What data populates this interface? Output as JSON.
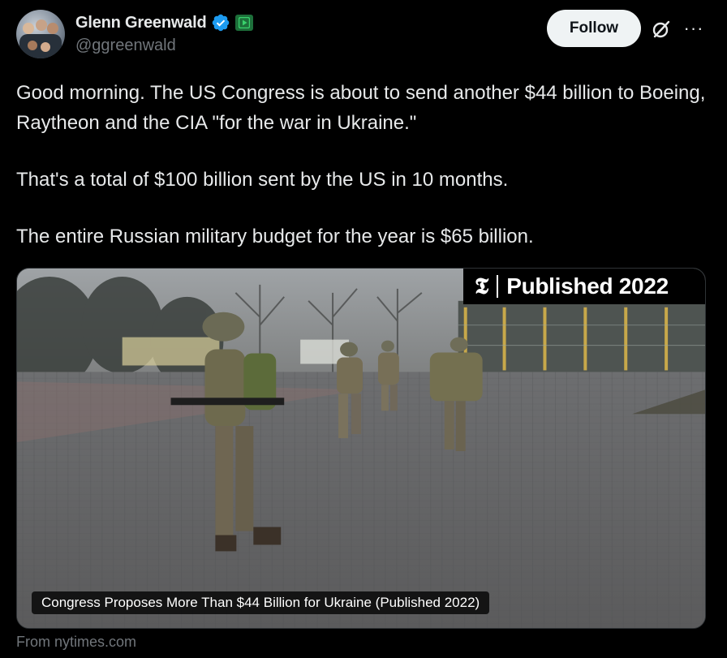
{
  "author": {
    "name": "Glenn Greenwald",
    "handle": "@ggreenwald",
    "verified": true,
    "verified_color": "#1d9bf0",
    "extra_badge_icon": "play-badge-icon"
  },
  "actions": {
    "follow_label": "Follow",
    "grok_icon": "grok-icon",
    "more_icon": "more-options-icon"
  },
  "tweet": {
    "paragraphs": [
      "Good morning. The US Congress is about to send another $44 billion to Boeing, Raytheon and the CIA \"for the war in Ukraine.\"",
      "That's a total of $100 billion sent by the US in 10 months.",
      "The entire Russian military budget for the year is $65 billion."
    ]
  },
  "card": {
    "banner_logo": "𝕿",
    "banner_text": "Published 2022",
    "caption": "Congress Proposes More Than $44 Billion for Ukraine (Published 2022)",
    "source": "From nytimes.com"
  },
  "colors": {
    "background": "#000000",
    "text_primary": "#e7e9ea",
    "text_secondary": "#71767b",
    "follow_button_bg": "#eff3f4"
  }
}
